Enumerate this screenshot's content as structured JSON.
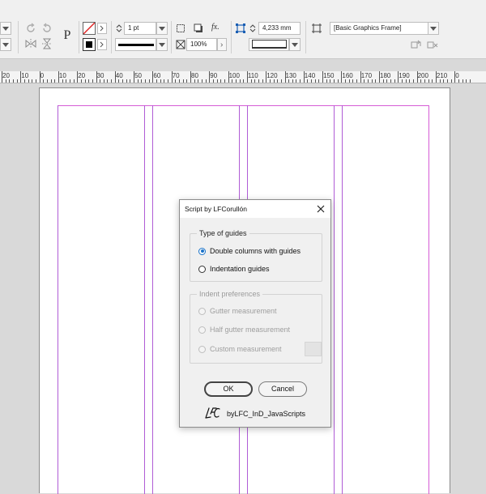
{
  "control_panel": {
    "stroke_weight": "1 pt",
    "reference_point_value": "4,233 mm",
    "scale_percent": "100%",
    "object_style": "[Basic Graphics Frame]",
    "fx_label": "fx.",
    "text_frame_glyph": "P"
  },
  "ruler": {
    "labels": [
      "20",
      "10",
      "0",
      "10",
      "20",
      "30",
      "40",
      "50",
      "60",
      "70",
      "80",
      "90",
      "100",
      "110",
      "120",
      "130",
      "140",
      "150",
      "160",
      "170",
      "180",
      "190",
      "200",
      "210",
      "0"
    ]
  },
  "dialog": {
    "title": "Script by LFCorullón",
    "type_group": {
      "label": "Type of guides",
      "options": [
        {
          "label": "Double columns with guides",
          "checked": true
        },
        {
          "label": "Indentation guides",
          "checked": false
        }
      ]
    },
    "indent_group": {
      "label": "Indent preferences",
      "options": [
        {
          "label": "Gutter measurement"
        },
        {
          "label": "Half gutter measurement"
        },
        {
          "label": "Custom measurement"
        }
      ]
    },
    "ok_label": "OK",
    "cancel_label": "Cancel",
    "credit": "byLFC_InD_JavaScripts",
    "logo_text": "LFC"
  },
  "colors": {
    "guide_column": "#b05cd6",
    "guide_margin": "#d65cd6",
    "radio_accent": "#1a73c9"
  }
}
